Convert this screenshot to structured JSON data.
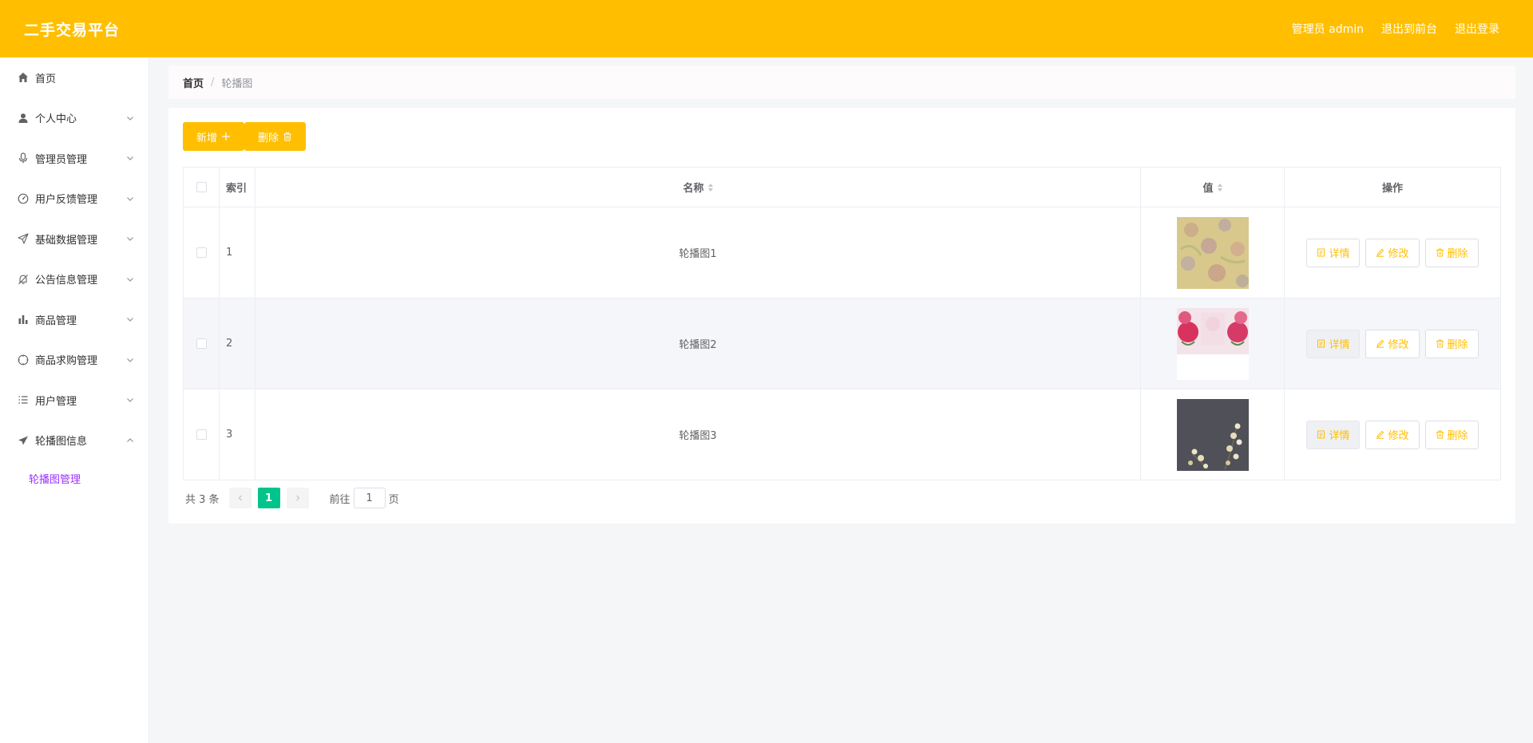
{
  "header": {
    "brand": "二手交易平台",
    "user": "管理员 admin",
    "to_front": "退出到前台",
    "logout": "退出登录"
  },
  "sidebar": {
    "items": [
      {
        "label": "首页",
        "icon": "home-icon",
        "has_arrow": false
      },
      {
        "label": "个人中心",
        "icon": "user-icon",
        "has_arrow": true
      },
      {
        "label": "管理员管理",
        "icon": "microphone-icon",
        "has_arrow": true
      },
      {
        "label": "用户反馈管理",
        "icon": "gauge-icon",
        "has_arrow": true
      },
      {
        "label": "基础数据管理",
        "icon": "send-icon",
        "has_arrow": true
      },
      {
        "label": "公告信息管理",
        "icon": "bell-off-icon",
        "has_arrow": true
      },
      {
        "label": "商品管理",
        "icon": "bar-chart-icon",
        "has_arrow": true
      },
      {
        "label": "商品求购管理",
        "icon": "compass-icon",
        "has_arrow": true
      },
      {
        "label": "用户管理",
        "icon": "list-icon",
        "has_arrow": true
      },
      {
        "label": "轮播图信息",
        "icon": "paper-plane-icon",
        "has_arrow": true,
        "expanded": true
      }
    ],
    "sub_items": [
      {
        "label": "轮播图管理",
        "active": true
      }
    ]
  },
  "breadcrumb": {
    "home": "首页",
    "separator": "/",
    "current": "轮播图"
  },
  "toolbar": {
    "add_label": "新增",
    "delete_label": "删除"
  },
  "table": {
    "columns": {
      "index": "索引",
      "name": "名称",
      "value": "值",
      "ops": "操作"
    },
    "rows": [
      {
        "index": "1",
        "name": "轮播图1",
        "image": "floral-pattern"
      },
      {
        "index": "2",
        "name": "轮播图2",
        "image": "pink-roses"
      },
      {
        "index": "3",
        "name": "轮播图3",
        "image": "dark-flowers"
      }
    ],
    "ops": {
      "detail": "详情",
      "edit": "修改",
      "delete": "删除"
    }
  },
  "pagination": {
    "total": "共 3 条",
    "current_page": "1",
    "goto_prefix": "前往",
    "goto_value": "1",
    "goto_suffix": "页"
  },
  "colors": {
    "accent": "#ffbf00",
    "active_page": "#00c48c",
    "active_submenu": "#9b30ff"
  }
}
